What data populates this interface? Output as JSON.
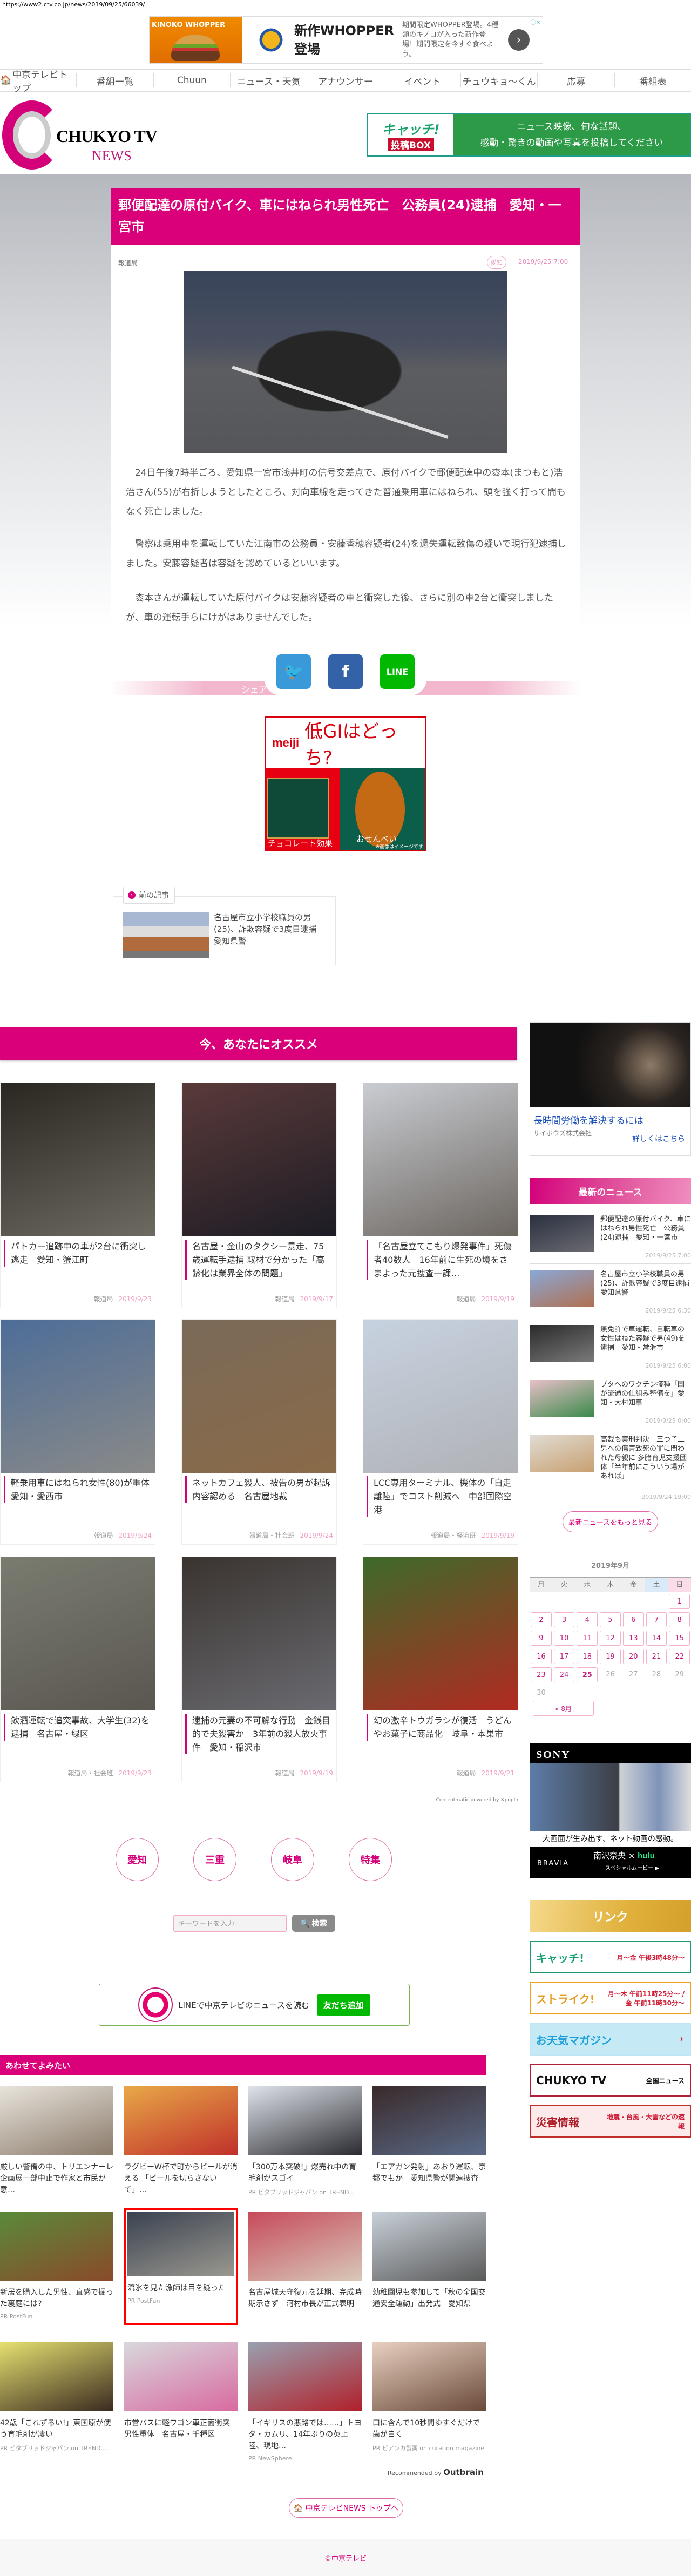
{
  "url": "https://www2.ctv.co.jp/news/2019/09/25/66039/",
  "top_ad": {
    "brand_image_text": "KINOKO WHOPPER",
    "headline": "新作WHOPPER登場",
    "description": "期間限定WHOPPER登場。4種類のキノコが入った新作登場！期間限定を今すぐ食べよう。",
    "arrow": "›",
    "ad_marker": "ⓘ✕"
  },
  "nav": [
    {
      "label": "中京テレビトップ"
    },
    {
      "label": "番組一覧"
    },
    {
      "label": "Chuun"
    },
    {
      "label": "ニュース・天気"
    },
    {
      "label": "アナウンサー"
    },
    {
      "label": "イベント"
    },
    {
      "label": "チュウキョ～くん"
    },
    {
      "label": "応募"
    },
    {
      "label": "番組表"
    }
  ],
  "logo": {
    "name": "CHUKYO TV",
    "sub": "NEWS"
  },
  "catch_banner": {
    "logo": "キャッチ!",
    "box": "投稿BOX",
    "line1": "ニュース映像、旬な話題、",
    "line2": "感動・驚きの動画や写真を投稿してください"
  },
  "article": {
    "title": "郵便配達の原付バイク、車にはねられ男性死亡　公務員(24)逮捕　愛知・一宮市",
    "department": "報道局",
    "tag": "愛知",
    "datetime": "2019/9/25 7:00",
    "paragraphs": [
      "24日午後7時半ごろ、愛知県一宮市浅井町の信号交差点で、原付バイクで郵便配達中の枩本(まつもと)浩治さん(55)が右折しようとしたところ、対向車線を走ってきた普通乗用車にはねられ、頭を強く打って間もなく死亡しました。",
      "警察は乗用車を運転していた江南市の公務員・安藤香穂容疑者(24)を過失運転致傷の疑いで現行犯逮捕しました。安藤容疑者は容疑を認めているといいます。",
      "枩本さんが運転していた原付バイクは安藤容疑者の車と衝突した後、さらに別の車2台と衝突しましたが、車の運転手らにけがはありませんでした。"
    ]
  },
  "share": {
    "label": "シェア",
    "twitter": "🐦",
    "facebook": "f",
    "line": "LINE"
  },
  "meiji_ad": {
    "brand": "meiji",
    "headline": "低GIはどっち?",
    "left": "チョコレート効果",
    "right": "おせんべい",
    "note": "※画像はイメージです"
  },
  "prev_article": {
    "label": "前の記事",
    "arrow": "‹",
    "title": "名古屋市立小学校職員の男(25)、詐欺容疑で3度目逮捕　愛知県警"
  },
  "recommend": {
    "heading": "今、あなたにオススメ",
    "items": [
      {
        "title": "パトカー追跡中の車が2台に衝突し逃走　愛知・蟹江町",
        "dept": "報道局",
        "date": "2019/9/23",
        "c1": "#2a2620",
        "c2": "#6d6a62"
      },
      {
        "title": "名古屋・金山のタクシー暴走、75歳運転手逮捕 取材で分かった「高齢化は業界全体の問題」",
        "dept": "報道局",
        "date": "2019/9/17",
        "c1": "#5a3a3a",
        "c2": "#1c1c24"
      },
      {
        "title": "「名古屋立てこもり爆発事件」死傷者40数人　16年前に生死の境をさまよった元捜査一課…",
        "dept": "報道局",
        "date": "2019/9/19",
        "c1": "#c9ccd2",
        "c2": "#6c6660"
      },
      {
        "title": "軽乗用車にはねられ女性(80)が重体　愛知・愛西市",
        "dept": "報道局",
        "date": "2019/9/24",
        "c1": "#4d6d98",
        "c2": "#8a8a88"
      },
      {
        "title": "ネットカフェ殺人、被告の男が起訴内容認める　名古屋地裁",
        "dept": "報道局・社会班",
        "date": "2019/9/24",
        "c1": "#7a6a58",
        "c2": "#8a6a48"
      },
      {
        "title": "LCC専用ターミナル、機体の「自走離陸」でコスト削減へ　中部国際空港",
        "dept": "報道局・経済班",
        "date": "2019/9/19",
        "c1": "#c7d2e0",
        "c2": "#b0b2b6"
      },
      {
        "title": "飲酒運転で追突事故、大学生(32)を逮捕　名古屋・緑区",
        "dept": "報道局・社会班",
        "date": "2019/9/23",
        "c1": "#7a7c70",
        "c2": "#5a5650"
      },
      {
        "title": "逮捕の元妻の不可解な行動　金銭目的で夫殺害か　3年前の殺人放火事件　愛知・稲沢市",
        "dept": "報道局",
        "date": "2019/9/19",
        "c1": "#3a3430",
        "c2": "#6a6a70"
      },
      {
        "title": "幻の激辛トウガラシが復活　うどんやお菓子に商品化　岐阜・本巣市",
        "dept": "報道局",
        "date": "2019/9/21",
        "c1": "#3d6a2a",
        "c2": "#b22a22"
      }
    ],
    "powered_by": "Contentmatic powered by ✕popIn"
  },
  "regions": [
    {
      "label": "愛知"
    },
    {
      "label": "三重"
    },
    {
      "label": "岐阜"
    },
    {
      "label": "特集"
    }
  ],
  "search": {
    "placeholder": "キーワードを入力",
    "value": "",
    "button": "🔍 検索"
  },
  "line_box": {
    "text": "LINEで中京テレビのニュースを読む",
    "button": "友だち追加"
  },
  "awase": {
    "heading": "あわせてよみたい",
    "items": [
      {
        "title": "厳しい警備の中、トリエンナーレ企画展一部中止で作家と市民が意…",
        "pr": "",
        "c1": "#e8e4dc",
        "c2": "#8a7a6a"
      },
      {
        "title": "ラグビーW杯で町からビールが消える 「ビールを切らさないで」…",
        "pr": "",
        "c1": "#e8a848",
        "c2": "#c0302a"
      },
      {
        "title": "「300万本突破!」爆売れ中の育毛剤がスゴイ",
        "pr": "PR ビタブリッドジャパン on TREND…",
        "c1": "#dfe4ea",
        "c2": "#2a2a30"
      },
      {
        "title": "「エアガン発射」あおり運転、京都でもか　愛知県警が関連捜査",
        "pr": "",
        "c1": "#3a2a2a",
        "c2": "#5a6a88"
      },
      {
        "title": "新居を購入した男性、直感で掘った裏庭には?",
        "pr": "PR PostFun",
        "c1": "#5a8a3a",
        "c2": "#8a4a2a"
      },
      {
        "title": "流氷を見た漁師は目を疑った",
        "pr": "PR PostFun",
        "c1": "#3a4250",
        "c2": "#9a9890"
      },
      {
        "title": "名古屋城天守復元を延期、完成時期示さず　河村市長が正式表明",
        "pr": "",
        "c1": "#c64a5a",
        "c2": "#d8c8b8"
      },
      {
        "title": "幼稚園児も参加して「秋の全国交通安全運動」出発式　愛知県",
        "pr": "",
        "c1": "#c8d0d8",
        "c2": "#5a5a5a"
      },
      {
        "title": "42歳「これずるい!」東国原が使う育毛剤が凄い",
        "pr": "PR ビタブリッドジャパン on TREND…",
        "c1": "#e6e070",
        "c2": "#3a2a20"
      },
      {
        "title": "市営バスに軽ワゴン車正面衝突　男性重体　名古屋・千種区",
        "pr": "",
        "c1": "#d8d8dc",
        "c2": "#d86aa0"
      },
      {
        "title": "「イギリスの悪路では……」トヨタ・カムリ、14年ぶりの英上陸、現地…",
        "pr": "PR NewSphere",
        "c1": "#9aa0b0",
        "c2": "#b0202a"
      },
      {
        "title": "口に含んで10秒間ゆすぐだけで歯が白く",
        "pr": "PR ビアンカ製薬 on curation magazine",
        "c1": "#e8d0c0",
        "c2": "#6a4a3a"
      }
    ],
    "recommended_by": "Recommended by",
    "outbrain": "Outbrain"
  },
  "top_link": "🏠 中京テレビNEWS トップへ",
  "footer": "©中京テレビ",
  "sidebar": {
    "ad": {
      "title": "長時間労働を解決するには",
      "company": "サイボウズ株式会社",
      "more": "詳しくはこちら"
    },
    "latest": {
      "heading": "最新のニュース",
      "items": [
        {
          "title": "郵便配達の原付バイク、車にはねられ男性死亡　公務員(24)逮捕　愛知・一宮市",
          "date": "2019/9/25 7:00",
          "c1": "#2a3040",
          "c2": "#6a6a70"
        },
        {
          "title": "名古屋市立小学校職員の男(25)、詐欺容疑で3度目逮捕　愛知県警",
          "date": "2019/9/25 6:30",
          "c1": "#8aa8d8",
          "c2": "#b07050"
        },
        {
          "title": "無免許で車運転、自転車の女性はねた容疑で男(49)を逮捕　愛知・常滑市",
          "date": "2019/9/25 6:00",
          "c1": "#2a2a2a",
          "c2": "#7a7a7a"
        },
        {
          "title": "ブタへのワクチン接種「国が流通の仕組み整備を」愛知・大村知事",
          "date": "2019/9/25 0:00",
          "c1": "#e8c0c8",
          "c2": "#3a8a4a"
        },
        {
          "title": "高裁も実刑判決　三つ子二男への傷害致死の罪に問われた母親に 多胎育児支援団体「半年前にこういう場があれば」",
          "date": "2019/9/24 19:00",
          "c1": "#e0dcd4",
          "c2": "#c8a070"
        }
      ],
      "more": "最新ニュースをもっと見る"
    },
    "calendar": {
      "title": "2019年9月",
      "weekdays": [
        "月",
        "火",
        "水",
        "木",
        "金",
        "土",
        "日"
      ],
      "leading_blanks": 6,
      "days_in_month": 30,
      "linked_through": 25,
      "today": 25,
      "prev": "« 8月"
    },
    "sony_ad": {
      "logo": "SONY",
      "copy": "大画面が生み出す、ネット動画の感動。",
      "brand": "BRAVIA",
      "collab": "南沢奈央 ×",
      "hulu": "hulu",
      "cta": "スペシャルムービー ▶"
    },
    "links": {
      "heading": "リンク",
      "items": [
        {
          "name": "キャッチ!",
          "time": "月～金 午後3時48分～",
          "border": "#1d9c6a",
          "bg": "#fff",
          "color": "#17a070"
        },
        {
          "name": "ストライク!",
          "time": "月～木 午前11時25分～ / 金 午前11時30分～",
          "border": "#f0a020",
          "bg": "#fff",
          "color": "#e89a1a"
        },
        {
          "name": "お天気マガジン",
          "time": "☀",
          "border": "#bfe6f4",
          "bg": "#c6e9f6",
          "color": "#1a9fd8"
        },
        {
          "name": "CHUKYO TV",
          "time": "全国ニュース",
          "border": "#b0203a",
          "bg": "#fff",
          "color": "#111"
        },
        {
          "name": "災害情報",
          "time": "地震・台風・大雪などの速報",
          "border": "#c0302a",
          "bg": "#fdeaea",
          "color": "#b0202a"
        }
      ]
    }
  }
}
